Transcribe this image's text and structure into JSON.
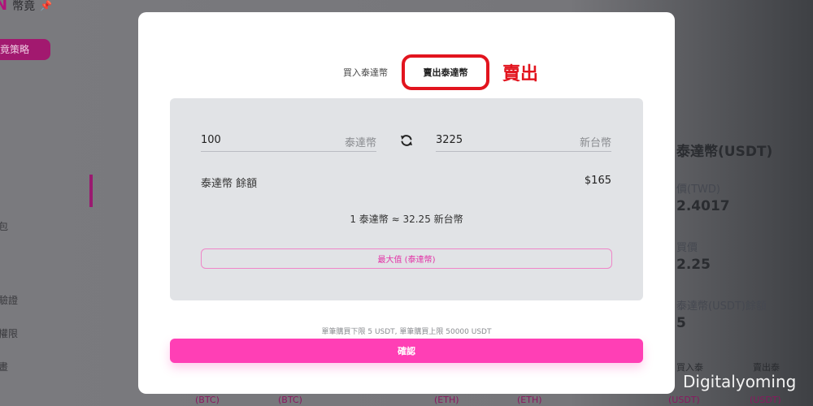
{
  "background": {
    "logo_text": "幣竟",
    "promo_button": "竟策略",
    "sidebar": [
      "包",
      "驗證",
      "權限",
      "畫"
    ],
    "right_panel": {
      "title": "泰達幣(USDT)",
      "twd_label": "價(TWD)",
      "twd_value": "2.4017",
      "label2": "買價",
      "value2": "2.25",
      "balance_label": "泰達幣(USDT)餘額",
      "balance_value": "5"
    },
    "table_tabs": [
      "買入泰",
      "賣出泰"
    ],
    "bottom_labels": [
      "(BTC)",
      "(BTC)",
      "(ETH)",
      "(ETH)",
      "(USDT)",
      "(USDT)"
    ]
  },
  "modal": {
    "tabs": {
      "buy": "買入泰達幣",
      "sell": "賣出泰達幣"
    },
    "annotation": "賣出",
    "from": {
      "value": "100",
      "unit": "泰達幣"
    },
    "to": {
      "value": "3225",
      "unit": "新台幣"
    },
    "balance": {
      "label": "泰達幣 餘額",
      "value": "$165"
    },
    "rate": "1 泰達幣 ≈ 32.25 新台幣",
    "max_button": "最大值 (泰達幣)",
    "limits": "單筆購買下限 5 USDT, 單筆購買上限 50000 USDT",
    "confirm": "確認"
  },
  "watermark": "Digitalyoming",
  "colors": {
    "accent": "#ff3fb5",
    "annotation_red": "#e2141e",
    "panel": "#e1e3e6"
  }
}
